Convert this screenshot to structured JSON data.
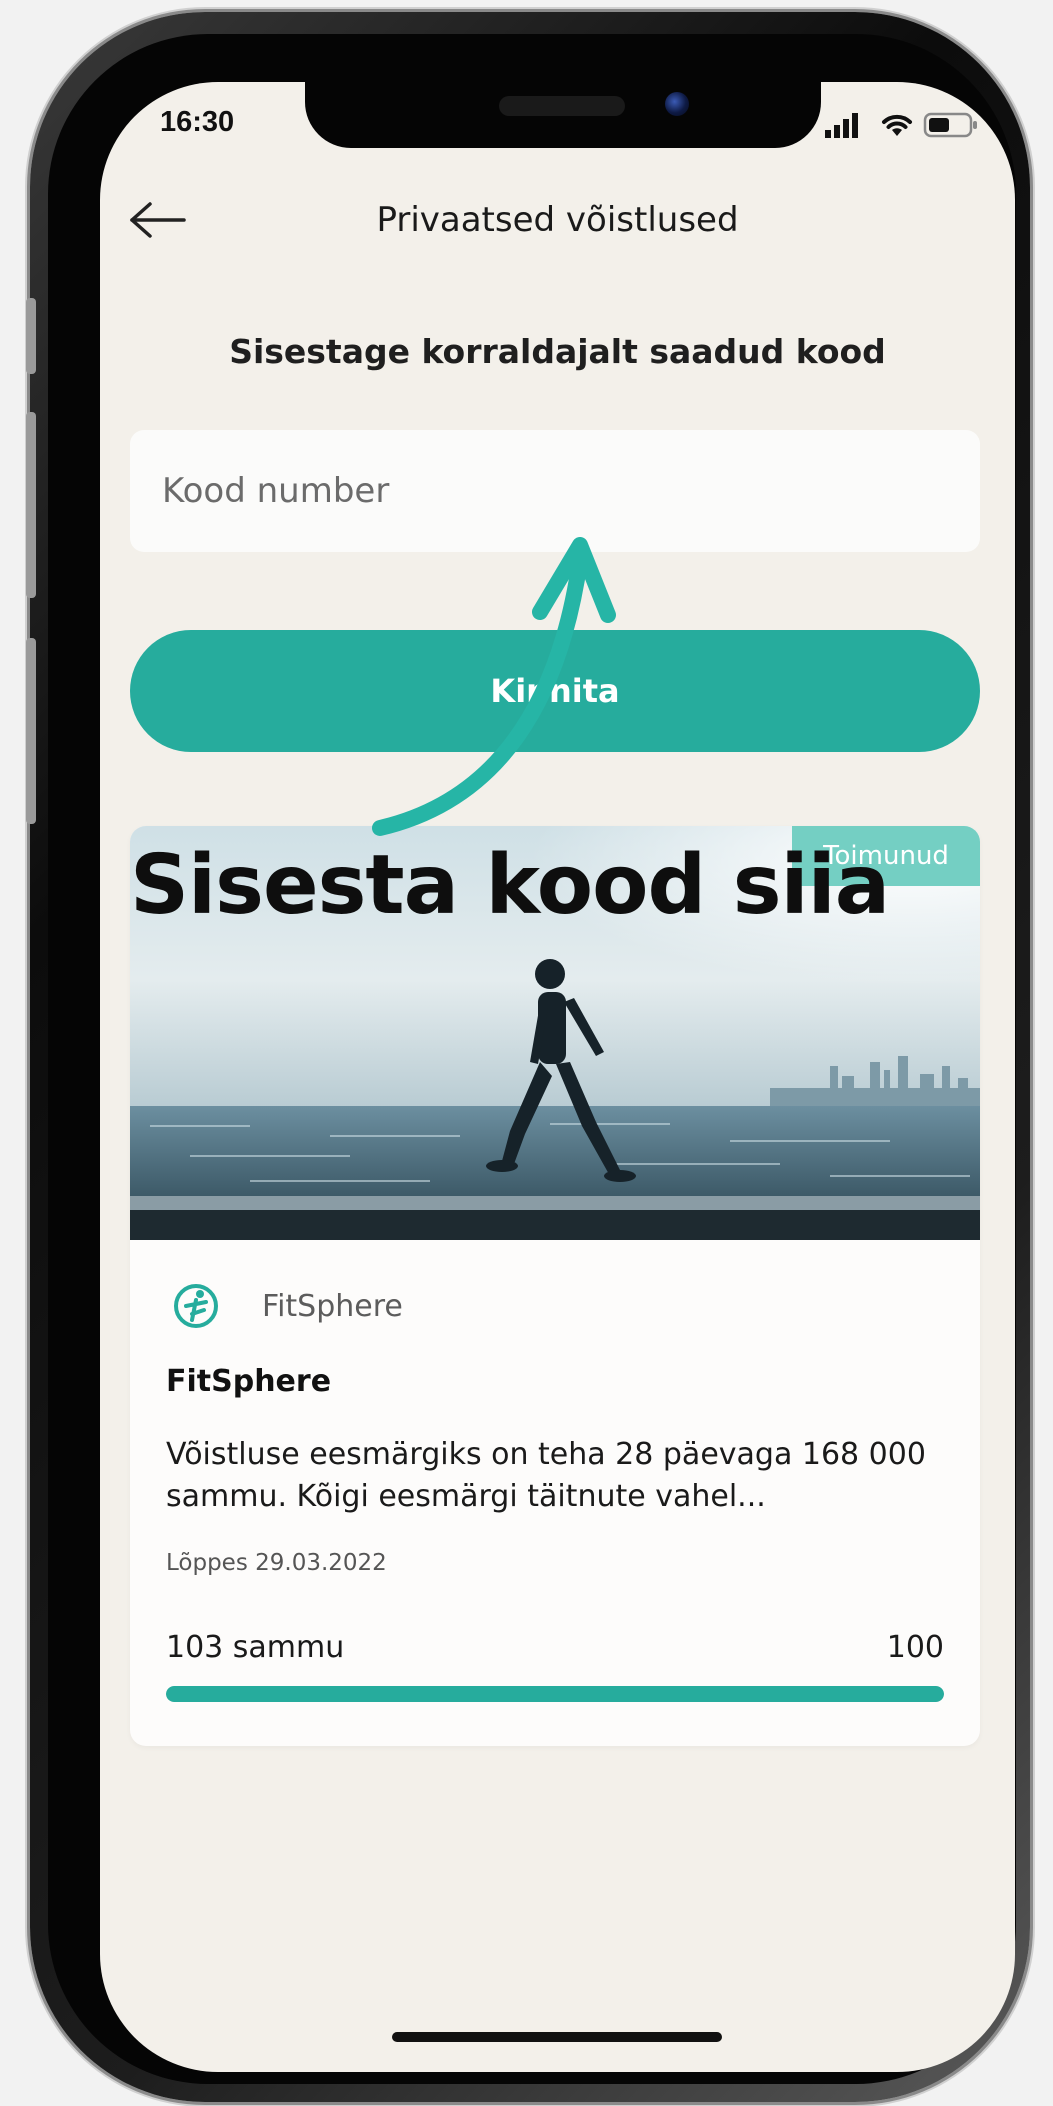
{
  "status_bar": {
    "time": "16:30"
  },
  "header": {
    "title": "Privaatsed võistlused",
    "back_icon": "arrow-left-icon"
  },
  "form": {
    "prompt": "Sisestage korraldajalt saadud kood",
    "code_placeholder": "Kood number",
    "code_value": "",
    "confirm_label": "Kinnita"
  },
  "challenge_card": {
    "badge": "Toimunud",
    "organizer": "FitSphere",
    "title": "FitSphere",
    "description": "Võistluse eesmärgiks on teha 28 päevaga 168 000 sammu. Kõigi eesmärgi täitnute vahel...",
    "end_date": "Lõppes 29.03.2022",
    "progress_label": "103 sammu",
    "progress_goal": "100",
    "progress_fraction": 1.0
  },
  "annotation": {
    "text": "Sisesta kood siia"
  },
  "colors": {
    "accent": "#26ac9d",
    "badge": "#74cfc3",
    "screen_bg": "#f3f0ea",
    "annotation_arrow": "#26b5a6"
  }
}
